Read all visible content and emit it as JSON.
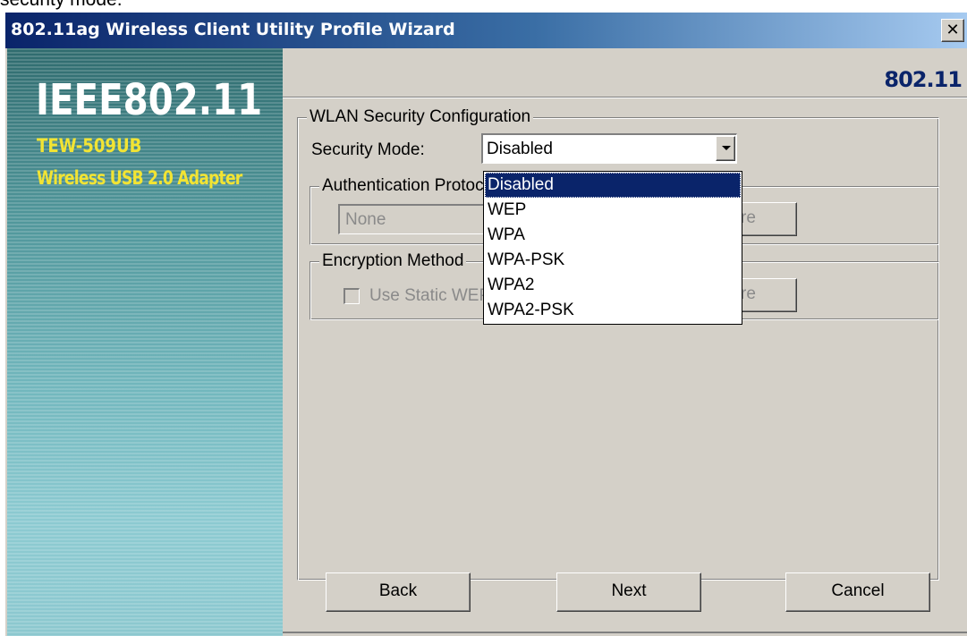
{
  "caption": "security mode.",
  "window": {
    "title": "802.11ag Wireless Client Utility Profile Wizard",
    "close_glyph": "✕"
  },
  "sidebar": {
    "brand_title": "IEEE802.11",
    "model": "TEW-509UB",
    "description": "Wireless USB 2.0 Adapter"
  },
  "header": {
    "logo": "802.11"
  },
  "wlan": {
    "legend": "WLAN Security Configuration",
    "security_mode_label": "Security Mode:",
    "security_mode_value": "Disabled",
    "options": [
      "Disabled",
      "WEP",
      "WPA",
      "WPA-PSK",
      "WPA2",
      "WPA2-PSK"
    ],
    "selected_option": "Disabled"
  },
  "auth": {
    "legend": "Authentication Protocol",
    "field_value": "None",
    "config_label": "re"
  },
  "encryption": {
    "legend": "Encryption Method",
    "checkbox_label": "Use Static WEP Keys",
    "checkbox_checked": false,
    "config_label": "re"
  },
  "footer": {
    "back_label": "Back",
    "next_label": "Next",
    "cancel_label": "Cancel"
  },
  "colors": {
    "title_bar": "#0a246a",
    "selection": "#0a246a",
    "panel": "#d4d0c8",
    "brand_accent": "#f2e433"
  },
  "icons": {
    "close": "close-icon",
    "dropdown": "chevron-down-icon",
    "checkbox": "checkbox-icon"
  }
}
